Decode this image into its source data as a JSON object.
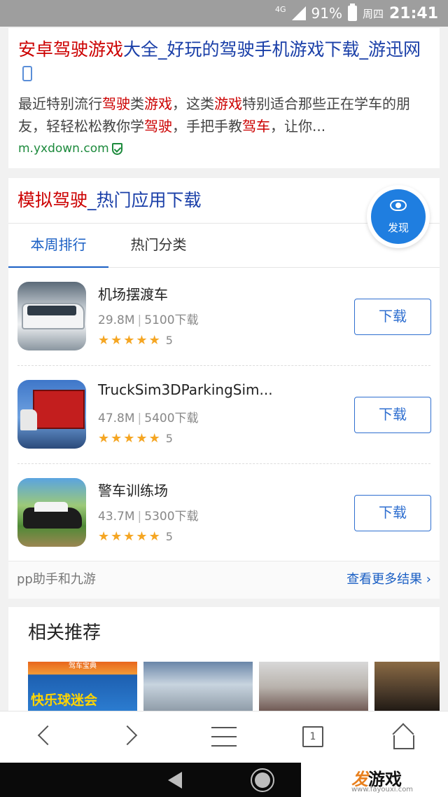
{
  "status_bar": {
    "network": "4G",
    "battery": "91%",
    "day": "周四",
    "time": "21:41"
  },
  "result1": {
    "title_hl": "安卓驾驶游戏",
    "title_rest": "大全_好玩的驾驶手机游戏下载_游迅网",
    "desc": [
      {
        "t": "最近特别流行",
        "hl": false
      },
      {
        "t": "驾驶",
        "hl": true
      },
      {
        "t": "类",
        "hl": false
      },
      {
        "t": "游戏",
        "hl": true
      },
      {
        "t": "，这类",
        "hl": false
      },
      {
        "t": "游戏",
        "hl": true
      },
      {
        "t": "特别适合那些正在学车的朋友，轻轻松松教你学",
        "hl": false
      },
      {
        "t": "驾驶",
        "hl": true
      },
      {
        "t": "，手把手教",
        "hl": false
      },
      {
        "t": "驾车",
        "hl": true
      },
      {
        "t": "，让你...",
        "hl": false
      }
    ],
    "url": "m.yxdown.com"
  },
  "result2": {
    "title_hl": "模拟驾驶",
    "title_rest": "_热门应用下载",
    "tabs": [
      "本周排行",
      "热门分类"
    ],
    "apps": [
      {
        "name": "机场摆渡车",
        "size": "29.8M",
        "downloads": "5100下载",
        "rating": "5",
        "button": "下载"
      },
      {
        "name": "TruckSim3DParkingSim...",
        "size": "47.8M",
        "downloads": "5400下载",
        "rating": "5",
        "button": "下载"
      },
      {
        "name": "警车训练场",
        "size": "43.7M",
        "downloads": "5300下载",
        "rating": "5",
        "button": "下载"
      }
    ],
    "source": "pp助手和九游",
    "more": "查看更多结果 ›"
  },
  "fab": {
    "label": "发现"
  },
  "related": {
    "title": "相关推荐",
    "thumb1_top": "驾车宝典",
    "thumb1_main": "快乐球迷会"
  },
  "toolbar": {
    "tab_count": "1"
  },
  "watermark": {
    "brand_a": "发",
    "brand_b": "游戏",
    "url": "www.fayouxi.com"
  }
}
